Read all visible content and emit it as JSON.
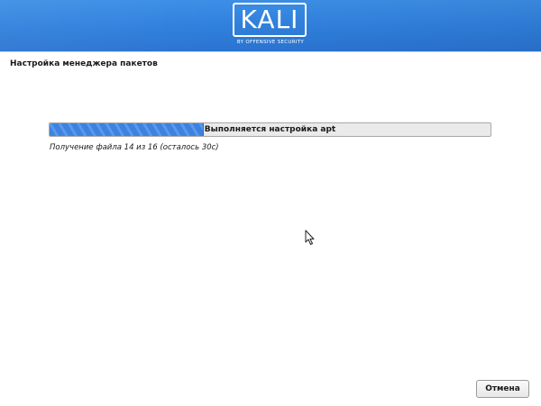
{
  "banner": {
    "logo_text": "KALI",
    "logo_subtitle": "BY OFFENSIVE SECURITY",
    "color": "#2f7fdc"
  },
  "page": {
    "title": "Настройка менеджера пакетов"
  },
  "progress": {
    "label": "Выполняется настройка apt",
    "status": "Получение файла 14 из 16 (осталось 30с)",
    "fraction": 0.35,
    "fill_color": "#3d82e0"
  },
  "footer": {
    "cancel_label": "Отмена"
  }
}
